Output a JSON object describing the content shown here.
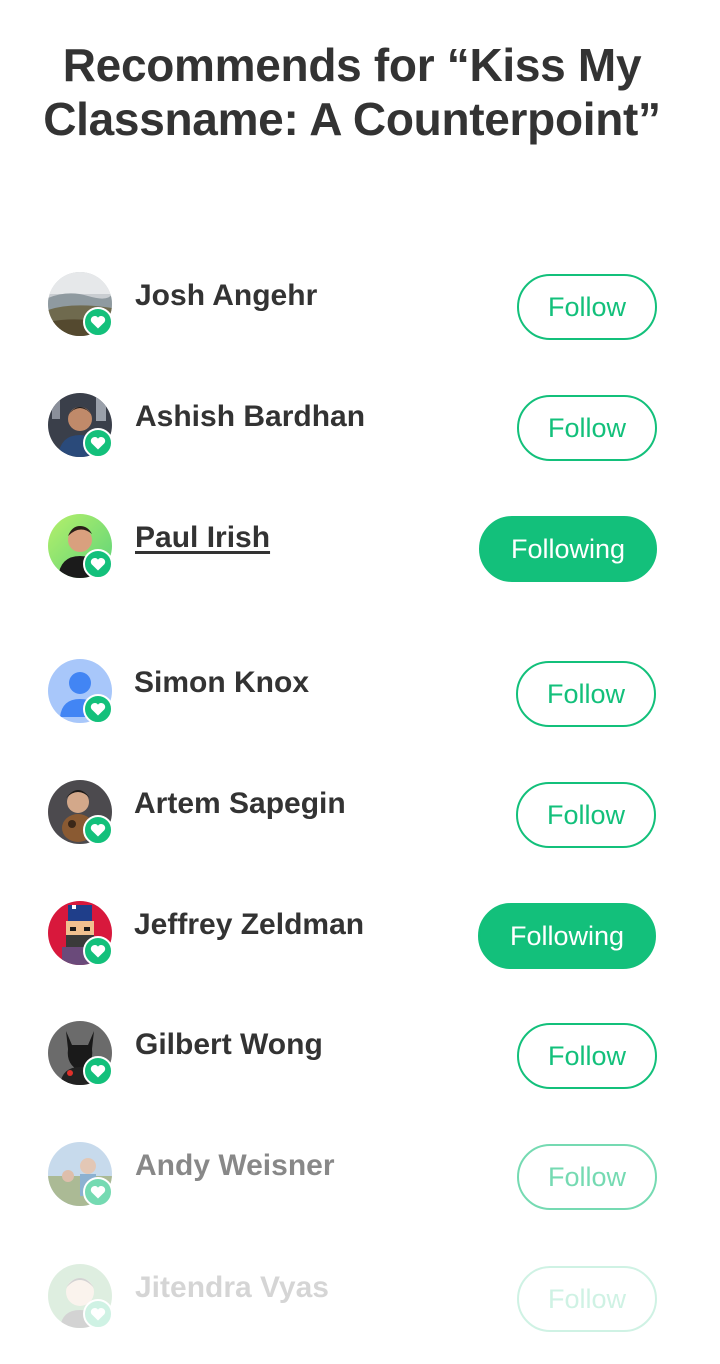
{
  "title": "Recommends for “Kiss My Classname: A Counterpoint”",
  "colors": {
    "accent": "#13c07b",
    "text": "#333333",
    "background": "#ffffff"
  },
  "people": [
    {
      "name": "Josh Angehr",
      "button_label": "Follow",
      "following": false,
      "avatar": "landscape-photo"
    },
    {
      "name": "Ashish Bardhan",
      "button_label": "Follow",
      "following": false,
      "avatar": "portrait-photo"
    },
    {
      "name": "Paul Irish",
      "button_label": "Following",
      "following": true,
      "avatar": "portrait-photo"
    },
    {
      "name": "Simon Knox",
      "button_label": "Follow",
      "following": false,
      "avatar": "default-user-icon"
    },
    {
      "name": "Artem Sapegin",
      "button_label": "Follow",
      "following": false,
      "avatar": "portrait-photo"
    },
    {
      "name": "Jeffrey Zeldman",
      "button_label": "Following",
      "following": true,
      "avatar": "pixel-art-portrait"
    },
    {
      "name": "Gilbert Wong",
      "button_label": "Follow",
      "following": false,
      "avatar": "dark-figure-photo"
    },
    {
      "name": "Andy Weisner",
      "button_label": "Follow",
      "following": false,
      "avatar": "outdoor-photo"
    },
    {
      "name": "Jitendra Vyas",
      "button_label": "Follow",
      "following": false,
      "avatar": "illustrated-portrait"
    }
  ]
}
